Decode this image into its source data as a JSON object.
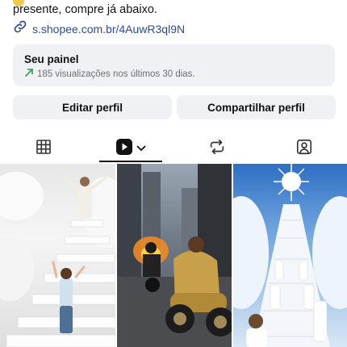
{
  "bio": {
    "line1": "",
    "line2": "presente, compre já abaixo.",
    "link": "s.shopee.com.br/4AuwR3ql9N"
  },
  "panel": {
    "title": "Seu painel",
    "subtitle": "185 visualizações nos últimos 30 dias."
  },
  "buttons": {
    "edit_profile": "Editar perfil",
    "share_profile": "Compartilhar perfil"
  },
  "tabs": {
    "items": [
      {
        "icon": "grid-icon"
      },
      {
        "icon": "reels-play-icon",
        "selected": true
      },
      {
        "icon": "repost-icon"
      },
      {
        "icon": "tagged-person-icon"
      }
    ]
  },
  "colors": {
    "panel_bg": "#eff1f4",
    "link": "#2f4a8a",
    "trend": "#2e9e4f"
  },
  "thumbnails": [
    {
      "icon": "stairway-heaven-image"
    },
    {
      "icon": "motorcycle-street-image"
    },
    {
      "icon": "stairway-sky-light-image"
    }
  ]
}
